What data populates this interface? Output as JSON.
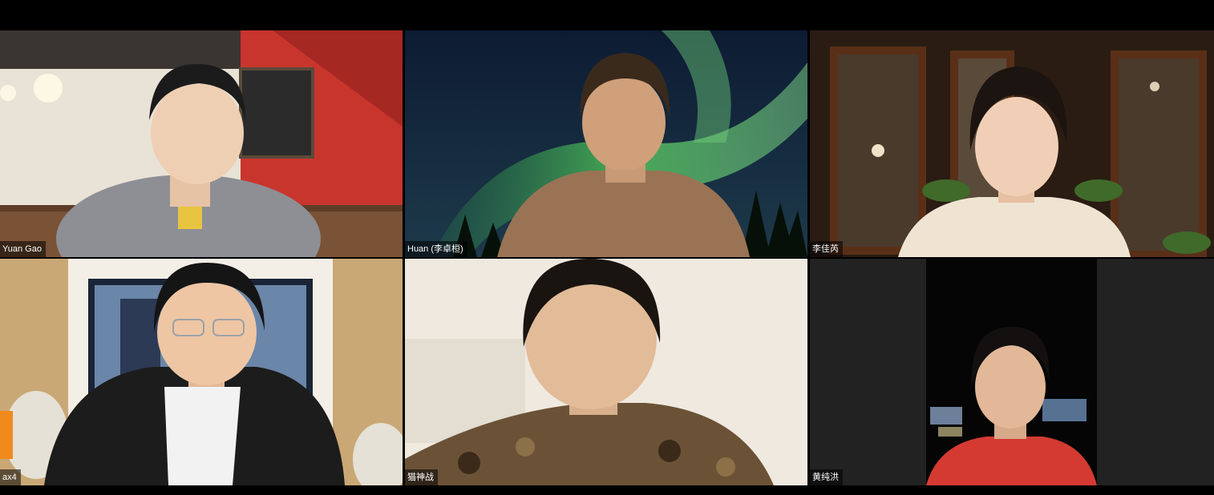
{
  "app": {
    "name": "Video conference gallery view"
  },
  "participants": [
    {
      "id": "p1",
      "name": "Yuan Gao",
      "background": "cafe-room"
    },
    {
      "id": "p2",
      "name": "Huan (李卓桓)",
      "background": "aurora-virtual"
    },
    {
      "id": "p3",
      "name": "李佳芮",
      "background": "window-room"
    },
    {
      "id": "p4",
      "name": "ax4",
      "background": "studio-room"
    },
    {
      "id": "p5",
      "name": "猫神战",
      "background": "plain-wall"
    },
    {
      "id": "p6",
      "name": "黄纯洪",
      "background": "dark-letterbox"
    }
  ],
  "colors": {
    "frame": "#000000",
    "label_bg": "rgba(0,0,0,0.55)",
    "label_text": "#ffffff",
    "aurora_green": "#4fbf5a",
    "cafe_red": "#c8352d"
  }
}
